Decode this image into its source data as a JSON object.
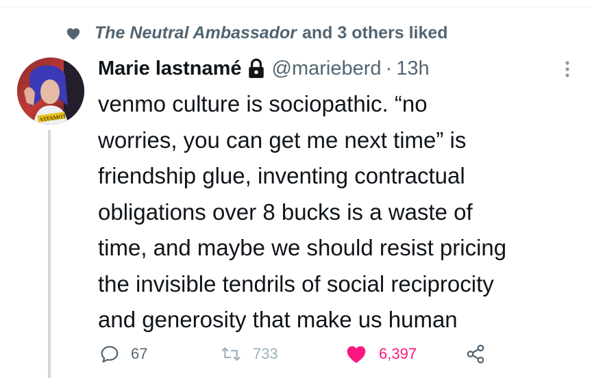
{
  "social_context": {
    "liker": "The Neutral Ambassador",
    "suffix": "and 3 others liked"
  },
  "tweet": {
    "display_name": "Marie lastnamé",
    "handle": "@marieberd",
    "separator": "·",
    "time": "13h",
    "text": "venmo culture is sociopathic. “no\nworries, you can get me next time” is\nfriendship glue, inventing contractual\nobligations over 8 bucks is a waste of\ntime, and maybe we should resist pricing\nthe invisible tendrils of social reciprocity\nand generosity that make us human",
    "avatar_shirt_text": "VITAMOT"
  },
  "actions": {
    "replies": "67",
    "retweets": "733",
    "likes": "6,397"
  },
  "colors": {
    "text": "#0f1419",
    "muted": "#536471",
    "like": "#f91880",
    "divider": "#cfd9de"
  },
  "icons": [
    "heart-icon",
    "lock-icon",
    "more-icon",
    "reply-icon",
    "retweet-icon",
    "like-heart-icon",
    "share-icon"
  ]
}
